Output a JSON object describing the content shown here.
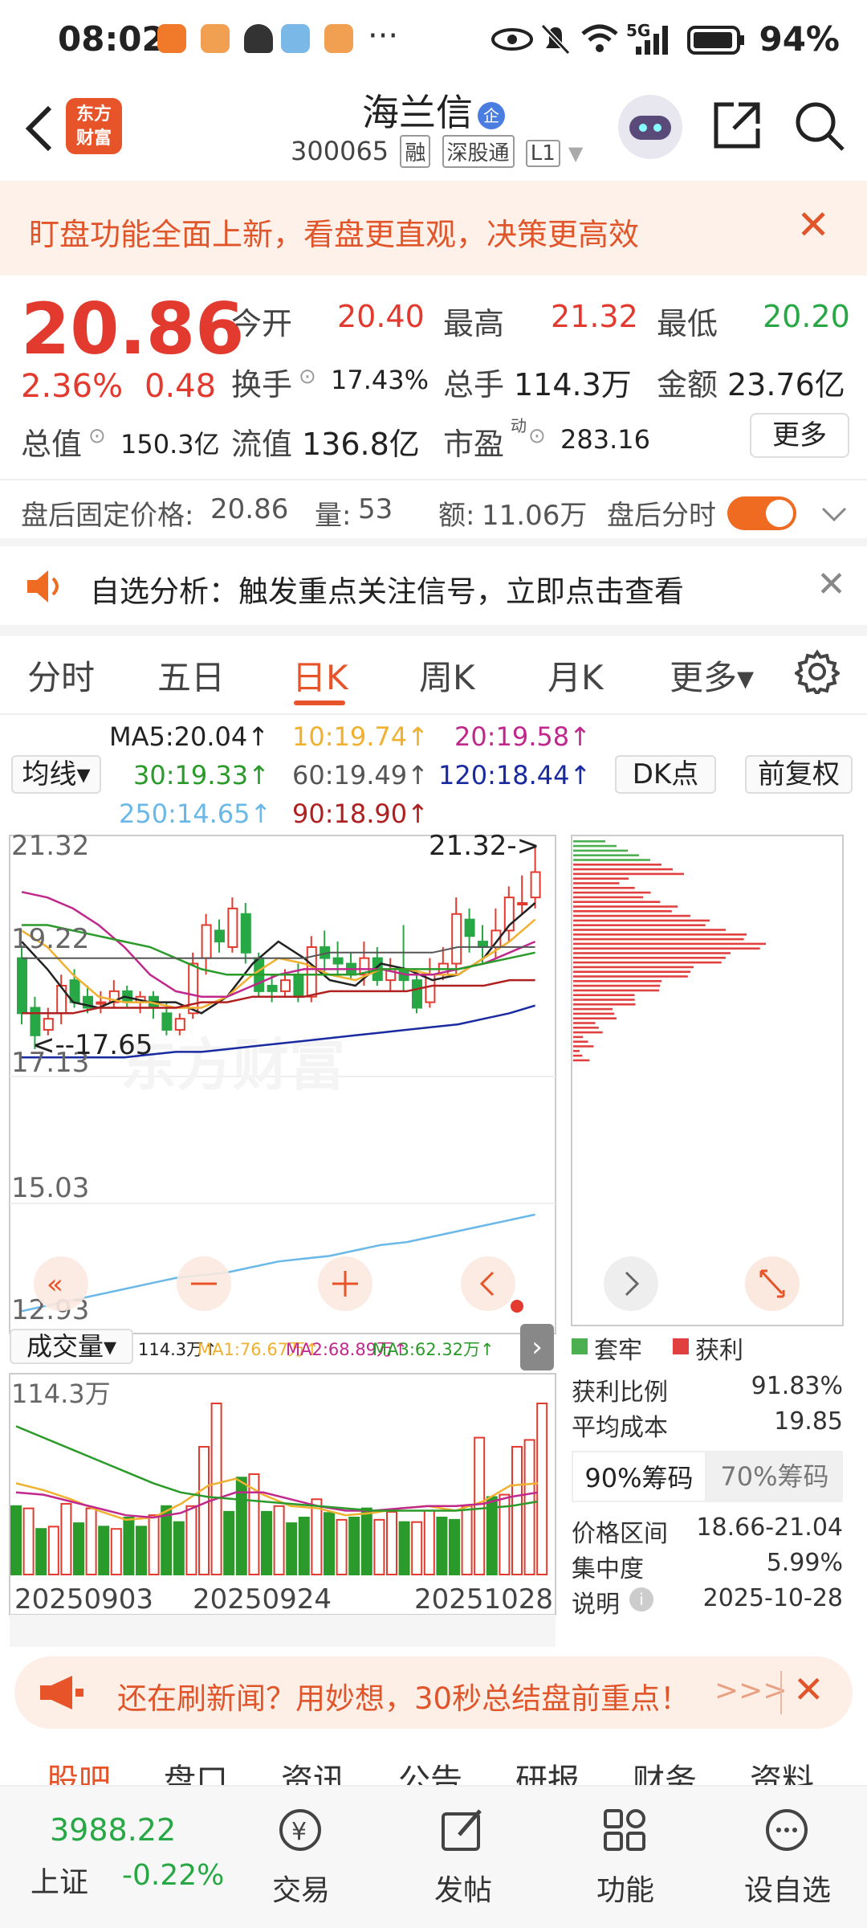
{
  "status": {
    "time": "08:02",
    "battery": "94%",
    "network": "5G"
  },
  "header": {
    "logo_line1": "东方",
    "logo_line2": "财富",
    "name": "海兰信",
    "badge": "企",
    "code": "300065",
    "tag1": "融",
    "tag2": "深股通",
    "tag3": "L1"
  },
  "banner1": {
    "text": "盯盘功能全面上新，看盘更直观，决策更高效"
  },
  "quote": {
    "price": "20.86",
    "change_pct": "2.36%",
    "change": "0.48",
    "open_label": "今开",
    "open": "20.40",
    "high_label": "最高",
    "high": "21.32",
    "low_label": "最低",
    "low": "20.20",
    "turnover_label": "换手",
    "turnover": "17.43%",
    "volume_label": "总手",
    "volume": "114.3万",
    "amount_label": "金额",
    "amount": "23.76亿",
    "mcap_label": "总值",
    "mcap": "150.3亿",
    "float_label": "流值",
    "float": "136.8亿",
    "pe_label": "市盈",
    "pe_sup": "动",
    "pe": "283.16",
    "more": "更多"
  },
  "after_hours": {
    "price_label": "盘后固定价格:",
    "price": "20.86",
    "vol_label": "量:",
    "vol": "53",
    "amt_label": "额:",
    "amt": "11.06万",
    "toggle_label": "盘后分时"
  },
  "analysis": {
    "text": "自选分析：触发重点关注信号，立即点击查看"
  },
  "tabs": [
    "分时",
    "五日",
    "日K",
    "周K",
    "月K",
    "更多▾"
  ],
  "legend": {
    "select": "均线▾",
    "ma5": "MA5:20.04↑",
    "ma10": "10:19.74↑",
    "ma20": "20:19.58↑",
    "ma30": "30:19.33↑",
    "ma60": "60:19.49↑",
    "ma120": "120:18.44↑",
    "ma250": "250:14.65↑",
    "ma90": "90:18.90↑",
    "dk": "DK点",
    "adj": "前复权",
    "colors": {
      "ma5": "#222222",
      "ma10": "#f0b030",
      "ma20": "#c0288c",
      "ma30": "#2a9a2a",
      "ma60": "#555555",
      "ma120": "#1a2aa0",
      "ma250": "#6ab8e8",
      "ma90": "#b02020"
    }
  },
  "chart": {
    "y_labels": [
      "21.32",
      "19.22",
      "17.13",
      "15.03",
      "12.93"
    ],
    "high_mark": "21.32->",
    "low_mark": "<--17.65",
    "watermark": "东方财富"
  },
  "volume": {
    "select": "成交量▾",
    "vol": "114.3万↑",
    "ma1": "MA1:76.67万↑",
    "ma2": "MA2:68.89万↑",
    "ma3": "MA3:62.32万↑",
    "top_label": "114.3万",
    "dates": [
      "20250903",
      "20250924",
      "20251028"
    ]
  },
  "chips": {
    "legend_trap": "套牢",
    "legend_profit": "获利",
    "profit_ratio_label": "获利比例",
    "profit_ratio": "91.83%",
    "avg_cost_label": "平均成本",
    "avg_cost": "19.85",
    "tab90": "90%筹码",
    "tab70": "70%筹码",
    "range_label": "价格区间",
    "range": "18.66-21.04",
    "conc_label": "集中度",
    "conc": "5.99%",
    "note_label": "说明",
    "note_date": "2025-10-28"
  },
  "banner2": {
    "text": "还在刷新闻？用妙想，30秒总结盘前重点！",
    "arrows": ">>>"
  },
  "bottom_tabs": [
    "股吧",
    "盘口",
    "资讯",
    "公告",
    "研报",
    "财务",
    "资料"
  ],
  "nav": {
    "index_value": "3988.22",
    "index_name": "上证",
    "index_change": "-0.22%",
    "items": [
      "交易",
      "发帖",
      "功能",
      "设自选"
    ]
  }
}
